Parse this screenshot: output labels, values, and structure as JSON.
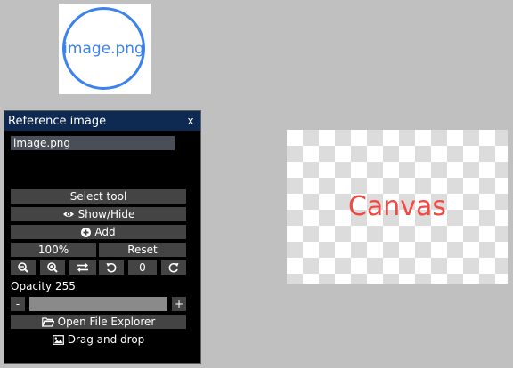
{
  "preview": {
    "text": "image.png",
    "accent": "#3b82f0"
  },
  "panel": {
    "title": "Reference image",
    "close_label": "x",
    "file_name": "image.png",
    "select_tool_label": "Select tool",
    "show_hide_label": "Show/Hide",
    "add_label": "Add",
    "zoom_value": "100%",
    "reset_label": "Reset",
    "rotation_value": "0",
    "opacity_label": "Opacity 255",
    "opacity_level": 1.0,
    "minus_label": "-",
    "plus_label": "+",
    "open_explorer_label": "Open File Explorer",
    "drag_drop_label": "Drag and drop",
    "icons": [
      "eye-icon",
      "plus-circle-icon",
      "zoom-out-icon",
      "zoom-in-icon",
      "swap-icon",
      "rotate-left-icon",
      "rotate-right-icon",
      "folder-open-icon",
      "image-icon"
    ]
  },
  "canvas": {
    "label": "Canvas",
    "label_color": "#f04a42"
  }
}
